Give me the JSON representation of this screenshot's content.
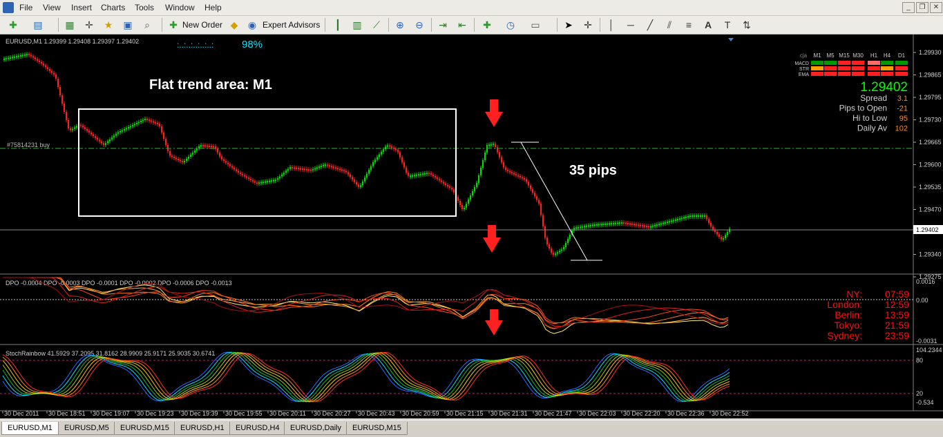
{
  "menu": [
    "File",
    "View",
    "Insert",
    "Charts",
    "Tools",
    "Window",
    "Help"
  ],
  "toolbar": {
    "new_order": "New Order",
    "expert_advisors": "Expert Advisors"
  },
  "chart": {
    "symbol_info": "EURUSD,M1  1.29399 1.29408 1.29397 1.29402",
    "progress_dots": ":..:..:..:..:..:",
    "progress_pct": "98%",
    "annotation_title": "Flat trend area: M1",
    "annotation_pips": "35 pips",
    "order_label": "#75814231 buy",
    "price_scale": [
      "1.29930",
      "1.29865",
      "1.29795",
      "1.29730",
      "1.29665",
      "1.29600",
      "1.29535",
      "1.29470",
      "1.29402",
      "1.29340",
      "1.29275"
    ],
    "current_price": "1.29402",
    "dpo_label": "DPO -0.0004  DPO -0.0003  DPO -0.0001  DPO -0.0002  DPO -0.0006  DPO -0.0013",
    "dpo_scale": [
      "0.0016",
      "0.00",
      "-0.0031"
    ],
    "stoch_label": "StochRainbow 41.5929 37.2095 31.8162 28.9909 25.9171 25.9035 30.6741",
    "stoch_scale": [
      "104.2344",
      "80",
      "20",
      "-0.534"
    ],
    "time_axis": [
      "30 Dec 2011",
      "30 Dec 18:51",
      "30 Dec 19:07",
      "30 Dec 19:23",
      "30 Dec 19:39",
      "30 Dec 19:55",
      "30 Dec 20:11",
      "30 Dec 20:27",
      "30 Dec 20:43",
      "30 Dec 20:59",
      "30 Dec 21:15",
      "30 Dec 21:31",
      "30 Dec 21:47",
      "30 Dec 22:03",
      "30 Dec 22:20",
      "30 Dec 22:36",
      "30 Dec 22:52"
    ]
  },
  "info_panel": {
    "header": [
      "cja",
      "M1",
      "M5",
      "M15",
      "M30",
      "H1",
      "H4",
      "D1"
    ],
    "rows": [
      "MACD",
      "STR",
      "EMA"
    ],
    "price": "1.29402",
    "stats": [
      {
        "label": "Spread",
        "value": "3.1"
      },
      {
        "label": "Pips to Open",
        "value": "-21"
      },
      {
        "label": "Hi to Low",
        "value": "95"
      },
      {
        "label": "Daily Av",
        "value": "102"
      }
    ]
  },
  "sessions": [
    {
      "city": "NY:",
      "time": "07:59"
    },
    {
      "city": "London:",
      "time": "12:59"
    },
    {
      "city": "Berlin:",
      "time": "13:59"
    },
    {
      "city": "Tokyo:",
      "time": "21:59"
    },
    {
      "city": "Sydney:",
      "time": "23:59"
    }
  ],
  "tabs": [
    "EURUSD,M1",
    "EURUSD,M5",
    "EURUSD,M15",
    "EURUSD,H1",
    "EURUSD,H4",
    "EURUSD,Daily",
    "EURUSD,M15"
  ],
  "colors": {
    "bull": "#00e000",
    "bear": "#ff2020",
    "accent": "#00e5ff",
    "price_green": "#00ff00",
    "session_red": "#ff1010"
  }
}
